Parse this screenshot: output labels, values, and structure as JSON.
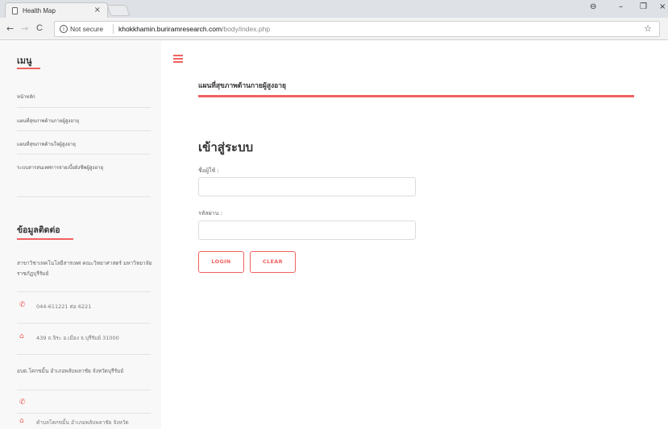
{
  "browser": {
    "tab_title": "Health Map",
    "tab_close": "×",
    "window_controls": [
      "⊖",
      "–",
      "❐",
      "×"
    ],
    "nav": {
      "back": "←",
      "forward": "→",
      "reload": "C"
    },
    "address": {
      "security_label": "Not secure",
      "url_host": "khokkhamin.buriramresearch.com",
      "url_path": "/body/index.php"
    },
    "bookmark_icon": "☆"
  },
  "sidebar": {
    "menu_heading": "เมนู",
    "menu_items": [
      {
        "label": "หน้าหลัก"
      },
      {
        "label": "แผนที่สุขภาพด้านกายผู้สูงอายุ"
      },
      {
        "label": "แผนที่สุขภาพด้านใจผู้สูงอายุ"
      },
      {
        "label": "ระบบสารสนเทศการจ่ายเบี้ยยังชีพผู้สูงอายุ"
      }
    ],
    "contact_heading": "ข้อมูลติดต่อ",
    "organization": "สาขาวิชาเทคโนโลยีสารเทศ คณะวิทยาศาสตร์ มหาวิทยาลัยราชภัฏบุรีรัมย์",
    "phone": "044-611221 ต่อ 6221",
    "address": "439 ถ.จิระ อ.เมือง จ.บุรีรัมย์ 31000",
    "second_org": "อบต.โคกขมิ้น อำเภอพลับพลาชัย จังหวัดบุรีรัมย์",
    "second_phone": "",
    "second_address": "ตำบลโคกขมิ้น อำเภอพลับพลาชัย จังหวัด",
    "icons": {
      "phone": "phone-icon",
      "home": "home-icon"
    }
  },
  "main": {
    "breadcrumb": "แผนที่สุขภาพด้านกายผู้สูงอายุ",
    "login_title": "เข้าสู่ระบบ",
    "username_label": "ชื่อผู้ใช้ :",
    "username_value": "",
    "password_label": "รหัสผ่าน :",
    "password_value": "",
    "login_button": "LOGIN",
    "clear_button": "CLEAR"
  },
  "colors": {
    "accent": "#f0625f",
    "sidebar_bg": "#f8f8f8"
  }
}
